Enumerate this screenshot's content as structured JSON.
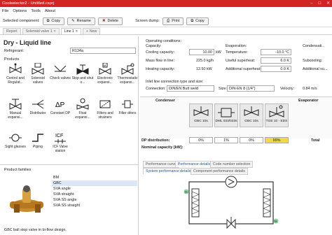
{
  "window": {
    "title": "Coolselector2 - Untitled.csprj",
    "min": "−",
    "max": "□",
    "close": "✕"
  },
  "menu": [
    "File",
    "Options",
    "Tools",
    "About"
  ],
  "toolbar": {
    "selected_component": "Selected component:",
    "copy": "Copy",
    "rename": "Rename",
    "delete": "Delete",
    "screen_dump": "Screen dump:",
    "print": "Print",
    "copy2": "Copy"
  },
  "tabs": [
    {
      "label": "Report"
    },
    {
      "label": "Solenoid valve 1"
    },
    {
      "label": "Line 1"
    },
    {
      "label": "New"
    }
  ],
  "left": {
    "title": "Dry - Liquid line",
    "refrigerant_label": "Refrigerant:",
    "refrigerant_value": "R134a",
    "products_label": "Products",
    "products": [
      "Control and Regulat...",
      "Solenoid valves",
      "Check valves",
      "Stop and shut o...",
      "Electronic expansi...",
      "Thermostatic expansi...",
      "Manual expansi...",
      "Distributor",
      "Constant DP",
      "Float expansi...",
      "Filters and strainers",
      "Filter driers",
      "Sight glasses",
      "Piping",
      "ICF Valve station"
    ],
    "families_label": "Product families",
    "families": [
      "BM",
      "GBC",
      "SVA angle",
      "SVA straight",
      "SVA SS angle",
      "SVA SS straight"
    ],
    "family_selected": 1,
    "family_desc": "GBC ball stop valve in bi-flow design."
  },
  "right": {
    "op_cond": "Operating conditions:",
    "capacity": "Capacity:",
    "cooling_capacity": "Cooling capacity:",
    "cooling_val": "10.00",
    "cooling_unit": "kW",
    "mass_flow": "Mass flow in line:",
    "mass_val": "225.0 kg/h",
    "heating": "Heating capacity:",
    "heating_val": "12.50 kW",
    "evaporation": "Evaporation:",
    "temperature": "Temperature:",
    "temp_val": "-10.0 °C",
    "superheat": "Useful superheat:",
    "superheat_val": "6.0 K",
    "add_superheat": "Additional superheat:",
    "add_superheat_val": "0.0 K",
    "condensation": "Condensati...",
    "subcooling": "Subcooling:",
    "add_sub": "Additional su...",
    "inlet_label": "Inlet line connection type and size:",
    "connection": "Connection:",
    "connection_val": "DIN/EN Butt weld",
    "size": "Size:",
    "size_val": "DIN-EN 8 (1/4\")",
    "velocity": "Velocity:",
    "velocity_val": "0.84 m/s",
    "condenser": "Condenser",
    "evaporator": "Evaporator",
    "valves": [
      "GBC 10s",
      "DML 033/033s",
      "GBC 10s",
      "TGE 10 - EDS"
    ],
    "dp_label": "DP distribution:",
    "dp_vals": [
      "0%",
      "1%",
      "0%",
      "99%"
    ],
    "total": "Total",
    "nominal": "Nominal capacity [kW]:",
    "perf_tabs": [
      "Performance curve",
      "Performance details",
      "Code number selection"
    ],
    "sub_tabs": [
      "System performance details",
      "Component performance details"
    ],
    "diagram_labels": [
      "1a",
      "3a"
    ]
  }
}
